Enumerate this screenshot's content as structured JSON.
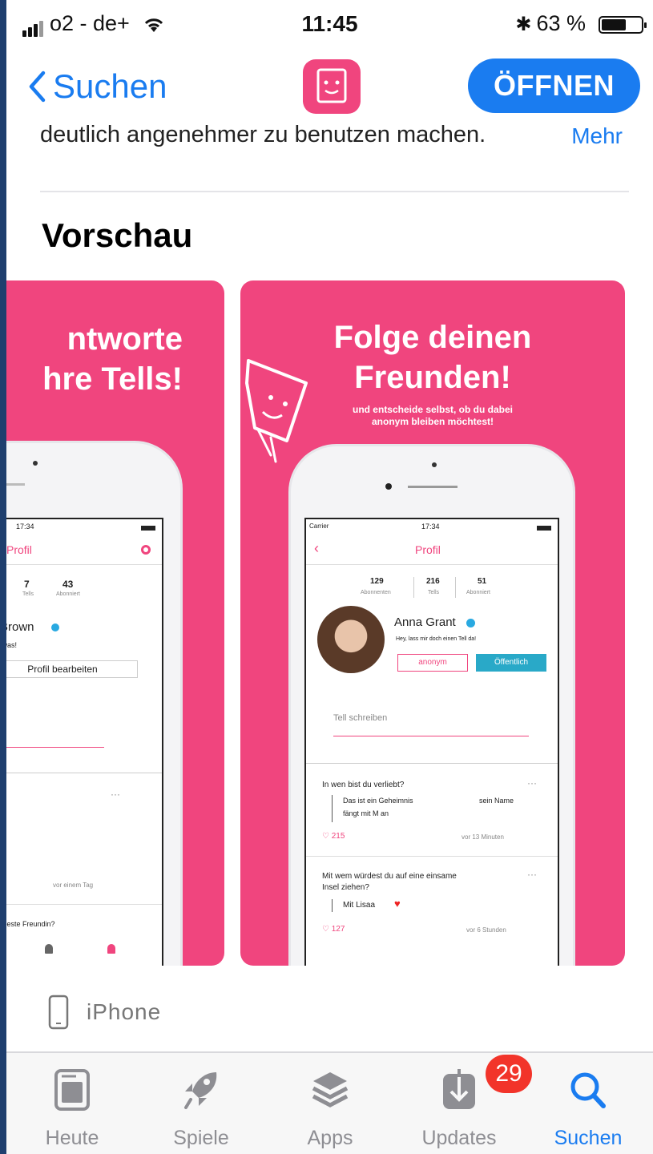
{
  "status_bar": {
    "carrier": "o2 - de+",
    "time": "11:45",
    "battery": "63 %",
    "battery_level": 0.63
  },
  "nav": {
    "back_label": "Suchen",
    "open_label": "ÖFFNEN"
  },
  "description": {
    "text": "deutlich angenehmer zu benutzen machen.",
    "more_label": "Mehr"
  },
  "preview": {
    "title": "Vorschau",
    "card1": {
      "headline_line1": "ntworte",
      "headline_line2": "hre Tells!",
      "time": "17:34",
      "profile": "Profil",
      "stat_tells": "7",
      "stat_tells_label": "Tells",
      "stat_abos": "43",
      "stat_abos_label": "Abonniert",
      "name": "sa Brown",
      "bio": "ft mir was!",
      "edit_button": "Profil bearbeiten",
      "post_time": "vor einem Tag",
      "post2": "eine beste Freundin?"
    },
    "card2": {
      "headline_line1": "Folge deinen",
      "headline_line2": "Freunden!",
      "subline_1": "und entscheide selbst, ob du dabei",
      "subline_2": "anonym bleiben möchtest!",
      "carrier": "Carrier",
      "time": "17:34",
      "profile": "Profil",
      "stat1": "129",
      "stat1_label": "Abonnenten",
      "stat2": "216",
      "stat2_label": "Tells",
      "stat3": "51",
      "stat3_label": "Abonniert",
      "name": "Anna Grant",
      "bio": "Hey, lass mir doch einen Tell da!",
      "anon_button": "anonym",
      "public_button": "Öffentlich",
      "input_placeholder": "Tell schreiben",
      "q1": "In wen bist du verliebt?",
      "a1_line1": "Das ist ein Geheimnis",
      "a1_line2": "sein Name",
      "a1_line3": "fängt mit M an",
      "likes1": "215",
      "time1": "vor 13 Minuten",
      "q2_line1": "Mit wem würdest du auf eine einsame",
      "q2_line2": "Insel ziehen?",
      "a2": "Mit Lisaa",
      "likes2": "127",
      "time2": "vor 6 Stunden"
    }
  },
  "device_label": "iPhone",
  "tabs": [
    {
      "label": "Heute",
      "icon": "today-icon"
    },
    {
      "label": "Spiele",
      "icon": "rocket-icon"
    },
    {
      "label": "Apps",
      "icon": "apps-stack-icon"
    },
    {
      "label": "Updates",
      "icon": "updates-download-icon"
    },
    {
      "label": "Suchen",
      "icon": "search-icon"
    }
  ],
  "updates_badge": "29",
  "colors": {
    "accent": "#1a7cf0",
    "brand_pink": "#f0457e",
    "badge_red": "#f2342a"
  }
}
